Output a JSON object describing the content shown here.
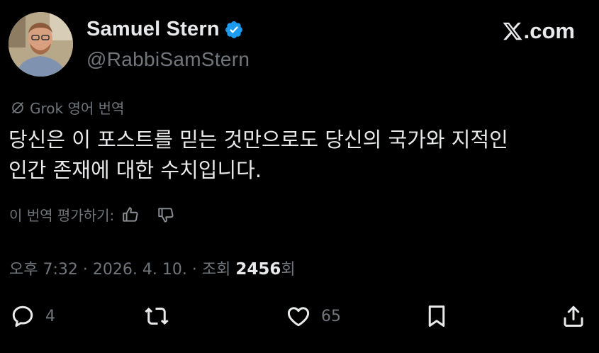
{
  "author": {
    "name": "Samuel Stern",
    "handle": "@RabbiSamStern"
  },
  "brand": {
    "logo_text": ".com"
  },
  "translation": {
    "label": "Grok 영어 번역"
  },
  "tweet": {
    "lines": [
      "당신은 이 포스트를 믿는 것만으로도 당신의 국가와 지적인",
      "인간 존재에 대한 수치입니다."
    ]
  },
  "rating": {
    "prompt": "이 번역 평가하기:"
  },
  "meta": {
    "time": "오후 7:32",
    "date": "2026. 4. 10.",
    "views_label": "조회",
    "views_count": "2456",
    "views_suffix": "회"
  },
  "actions": {
    "replies": "4",
    "likes": "65"
  },
  "colors": {
    "background": "#000000",
    "primary_text": "#e7e9ea",
    "secondary_text": "#71767b",
    "verified_badge": "#1d9bf0"
  }
}
